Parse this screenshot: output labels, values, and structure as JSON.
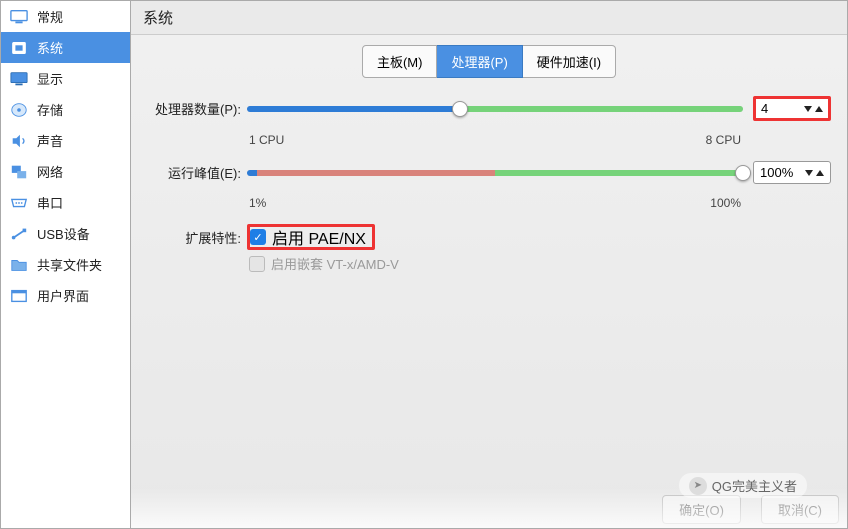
{
  "page_title": "系统",
  "sidebar": {
    "items": [
      {
        "label": "常规"
      },
      {
        "label": "系统"
      },
      {
        "label": "显示"
      },
      {
        "label": "存储"
      },
      {
        "label": "声音"
      },
      {
        "label": "网络"
      },
      {
        "label": "串口"
      },
      {
        "label": "USB设备"
      },
      {
        "label": "共享文件夹"
      },
      {
        "label": "用户界面"
      }
    ]
  },
  "tabs": [
    {
      "label": "主板(M)"
    },
    {
      "label": "处理器(P)"
    },
    {
      "label": "硬件加速(I)"
    }
  ],
  "cpu": {
    "label": "处理器数量(P):",
    "min_label": "1 CPU",
    "max_label": "8 CPU",
    "value": "4"
  },
  "cap": {
    "label": "运行峰值(E):",
    "min_label": "1%",
    "max_label": "100%",
    "value": "100%"
  },
  "ext": {
    "label": "扩展特性:",
    "pae": "启用 PAE/NX",
    "nested": "启用嵌套 VT-x/AMD-V"
  },
  "footer": {
    "ok": "确定(O)",
    "cancel": "取消(C)"
  },
  "watermark": "QG完美主义者"
}
